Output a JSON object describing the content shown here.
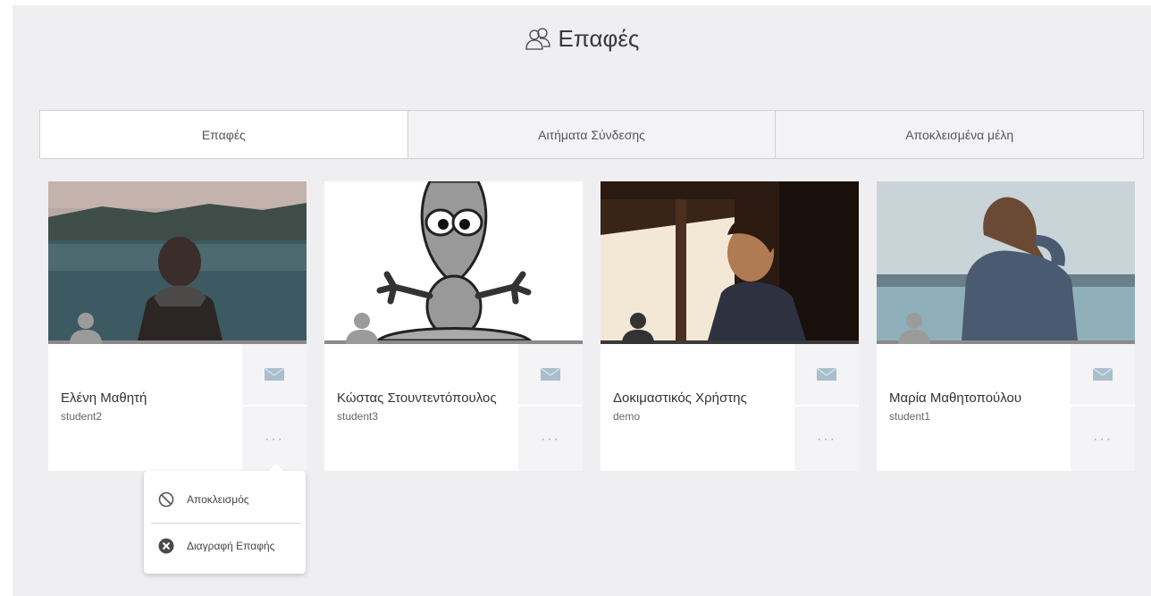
{
  "header": {
    "title": "Επαφές",
    "icon": "contacts-icon"
  },
  "tabs": [
    {
      "label": "Επαφές",
      "active": true
    },
    {
      "label": "Αιτήματα Σύνδεσης",
      "active": false
    },
    {
      "label": "Αποκλεισμένα μέλη",
      "active": false
    }
  ],
  "contacts": [
    {
      "name": "Ελένη Μαθητή",
      "username": "student2"
    },
    {
      "name": "Κώστας Στουντεντόπουλος",
      "username": "student3"
    },
    {
      "name": "Δοκιμαστικός Χρήστης",
      "username": "demo"
    },
    {
      "name": "Μαρία Μαθητοπούλου",
      "username": "student1"
    }
  ],
  "actions": {
    "more_label": "···"
  },
  "dropdown": {
    "block_label": "Αποκλεισμός",
    "delete_label": "Διαγραφή Επαφής"
  },
  "colors": {
    "panel_bg": "#efeff2",
    "mail_icon": "#a9bfcc"
  }
}
